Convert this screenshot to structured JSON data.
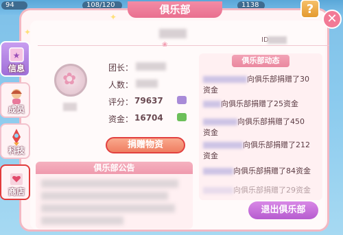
{
  "topbar": {
    "stat_left": "94",
    "stat_mid": "108/120",
    "stat_right": "1138"
  },
  "window": {
    "title": "俱乐部",
    "help_label": "?",
    "close_label": "✕"
  },
  "club": {
    "id_label": "ID:",
    "leader_label": "团长：",
    "members_label": "人数：",
    "rating_label": "评分：",
    "rating_value": "79637",
    "funds_label": "资金：",
    "funds_value": "16704"
  },
  "actions": {
    "donate_label": "捐赠物资",
    "exit_label": "退出俱乐部"
  },
  "tabs": [
    {
      "label": "信息",
      "icon": "info-book-icon"
    },
    {
      "label": "成员",
      "icon": "members-icon"
    },
    {
      "label": "科技",
      "icon": "rocket-icon"
    },
    {
      "label": "商店",
      "icon": "shop-heart-icon"
    }
  ],
  "notice": {
    "title": "俱乐部公告"
  },
  "feed": {
    "title": "俱乐部动态",
    "items": [
      {
        "line1": "向俱乐部捐赠了30",
        "line2": "资金"
      },
      {
        "line1": "向俱乐部捐赠了25资金",
        "line2": ""
      },
      {
        "line1": "向俱乐部捐赠了450",
        "line2": "资金"
      },
      {
        "line1": "向俱乐部捐赠了212",
        "line2": "资金"
      },
      {
        "line1": "向俱乐部捐赠了84资金",
        "line2": ""
      },
      {
        "line1": "向俱乐部捐赠了29资金",
        "line2": ""
      }
    ]
  },
  "colors": {
    "accent_pink": "#e96f8f",
    "donate_orange": "#ef7e62",
    "exit_purple": "#b65bcf",
    "highlight_red": "#e24040"
  }
}
